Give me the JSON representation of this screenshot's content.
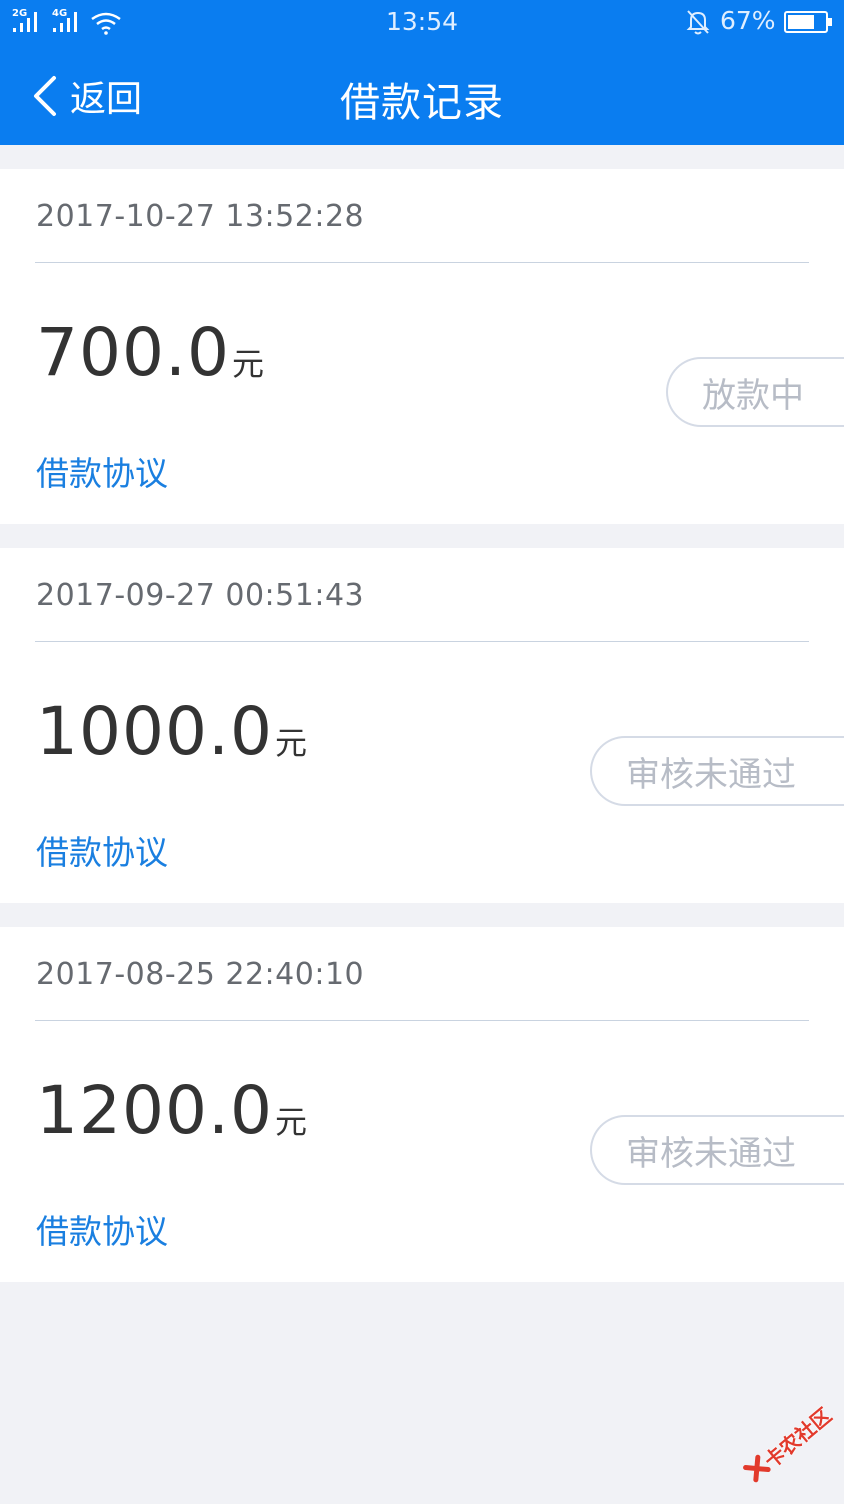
{
  "status_bar": {
    "network_1": "2G",
    "network_2": "4G",
    "time": "13:54",
    "battery_percent": "67%"
  },
  "header": {
    "back_label": "返回",
    "title": "借款记录"
  },
  "records": [
    {
      "datetime": "2017-10-27 13:52:28",
      "amount": "700.0",
      "unit": "元",
      "agreement_link": "借款协议",
      "status": "放款中"
    },
    {
      "datetime": "2017-09-27 00:51:43",
      "amount": "1000.0",
      "unit": "元",
      "agreement_link": "借款协议",
      "status": "审核未通过"
    },
    {
      "datetime": "2017-08-25 22:40:10",
      "amount": "1200.0",
      "unit": "元",
      "agreement_link": "借款协议",
      "status": "审核未通过"
    }
  ],
  "watermark": {
    "text": "卡农社区"
  },
  "icons": {
    "back": "chevron-left-icon",
    "signal": "signal-icon",
    "wifi": "wifi-icon",
    "bell": "bell-mute-icon",
    "battery": "battery-icon"
  },
  "colors": {
    "primary": "#0a7df0",
    "link": "#1a7fe0",
    "background": "#f1f2f6",
    "status_text": "#b7bcc6"
  }
}
